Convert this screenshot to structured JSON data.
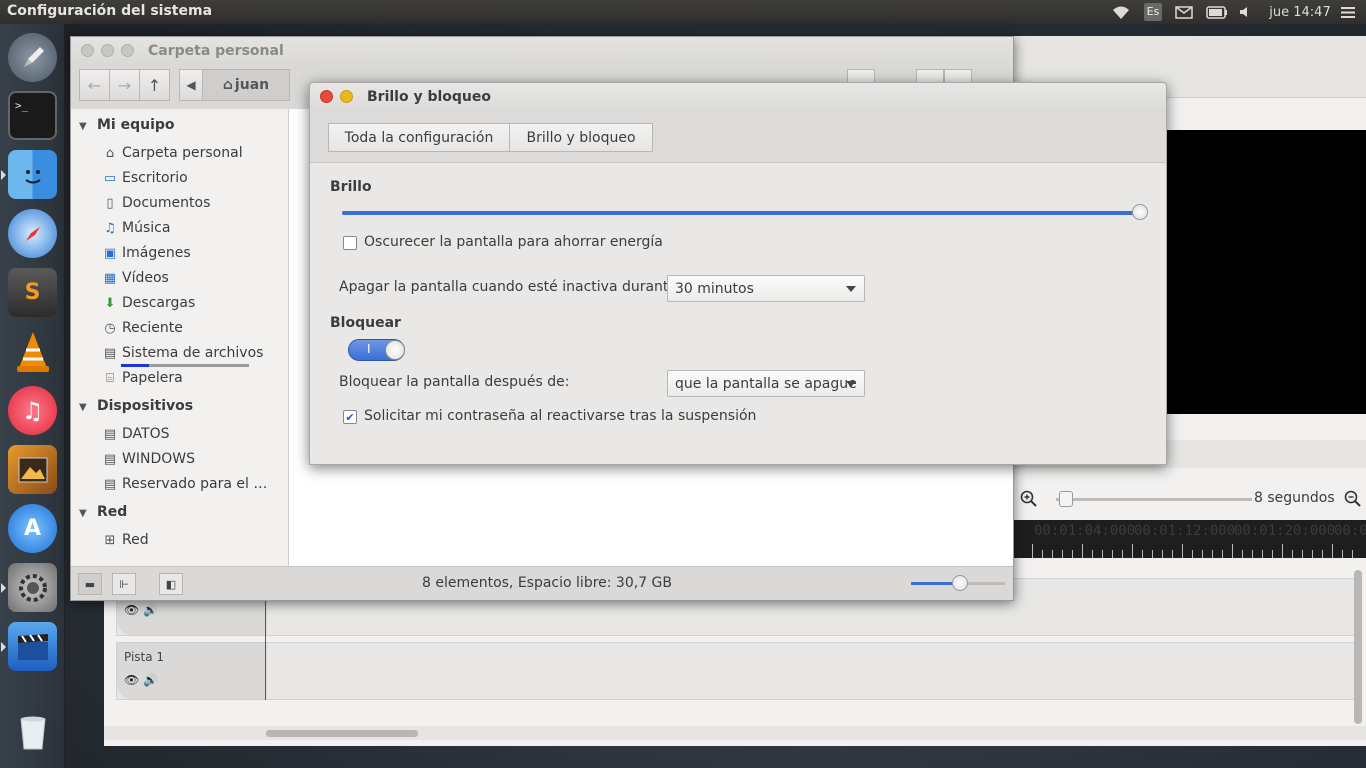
{
  "top_panel": {
    "app_title": "Configuración del sistema",
    "keyboard_layout": "Es",
    "clock": "jue 14:47"
  },
  "launcher": {
    "items": [
      {
        "name": "launchpad-icon"
      },
      {
        "name": "terminal-icon"
      },
      {
        "name": "finder-icon"
      },
      {
        "name": "safari-icon"
      },
      {
        "name": "sublime-text-icon"
      },
      {
        "name": "vlc-icon"
      },
      {
        "name": "itunes-icon"
      },
      {
        "name": "photos-icon"
      },
      {
        "name": "app-store-icon"
      },
      {
        "name": "system-settings-icon"
      },
      {
        "name": "video-editor-icon"
      },
      {
        "name": "trash-icon"
      }
    ]
  },
  "editor": {
    "zoom_label": "8 segundos",
    "ruler_labels": [
      "00:01:04:000",
      "00:01:12:000",
      "00:01:20:000",
      "00:0"
    ],
    "tracks": [
      {
        "name": ""
      },
      {
        "name": "Pista 1"
      }
    ]
  },
  "file_manager": {
    "title": "Carpeta personal",
    "path_button": "juan",
    "sections": [
      {
        "title": "Mi equipo",
        "items": [
          {
            "label": "Carpeta personal",
            "icon": "home-icon"
          },
          {
            "label": "Escritorio",
            "icon": "desktop-icon"
          },
          {
            "label": "Documentos",
            "icon": "document-icon"
          },
          {
            "label": "Música",
            "icon": "music-icon"
          },
          {
            "label": "Imágenes",
            "icon": "image-icon"
          },
          {
            "label": "Vídeos",
            "icon": "video-icon"
          },
          {
            "label": "Descargas",
            "icon": "download-icon"
          },
          {
            "label": "Reciente",
            "icon": "recent-icon"
          },
          {
            "label": "Sistema de archivos",
            "icon": "drive-icon"
          },
          {
            "label": "Papelera",
            "icon": "trash-icon"
          }
        ]
      },
      {
        "title": "Dispositivos",
        "items": [
          {
            "label": "DATOS",
            "icon": "drive-icon"
          },
          {
            "label": "WINDOWS",
            "icon": "drive-icon"
          },
          {
            "label": "Reservado para el …",
            "icon": "drive-icon"
          }
        ]
      },
      {
        "title": "Red",
        "items": [
          {
            "label": "Red",
            "icon": "network-icon"
          }
        ]
      }
    ],
    "status_text": "8 elementos, Espacio libre: 30,7 GB",
    "zoom_level": 0.52
  },
  "dialog": {
    "title": "Brillo y bloqueo",
    "breadcrumbs": [
      "Toda la configuración",
      "Brillo y bloqueo"
    ],
    "brightness": {
      "section_title": "Brillo",
      "level": 1.0,
      "dim_screen_label": "Oscurecer la pantalla para ahorrar energía",
      "dim_screen_checked": false,
      "off_label": "Apagar la pantalla cuando esté inactiva durante:",
      "off_value": "30 minutos"
    },
    "lock": {
      "section_title": "Bloquear",
      "toggle_on": true,
      "toggle_text": "I",
      "after_label": "Bloquear la pantalla después de:",
      "after_value": "que la pantalla se apague",
      "password_label": "Solicitar mi contraseña al reactivarse tras la suspensión",
      "password_checked": true
    }
  },
  "colors": {
    "accent": "#3b6fd4",
    "close_button": "#e84a3a",
    "minimize_button": "#e8b91f"
  }
}
